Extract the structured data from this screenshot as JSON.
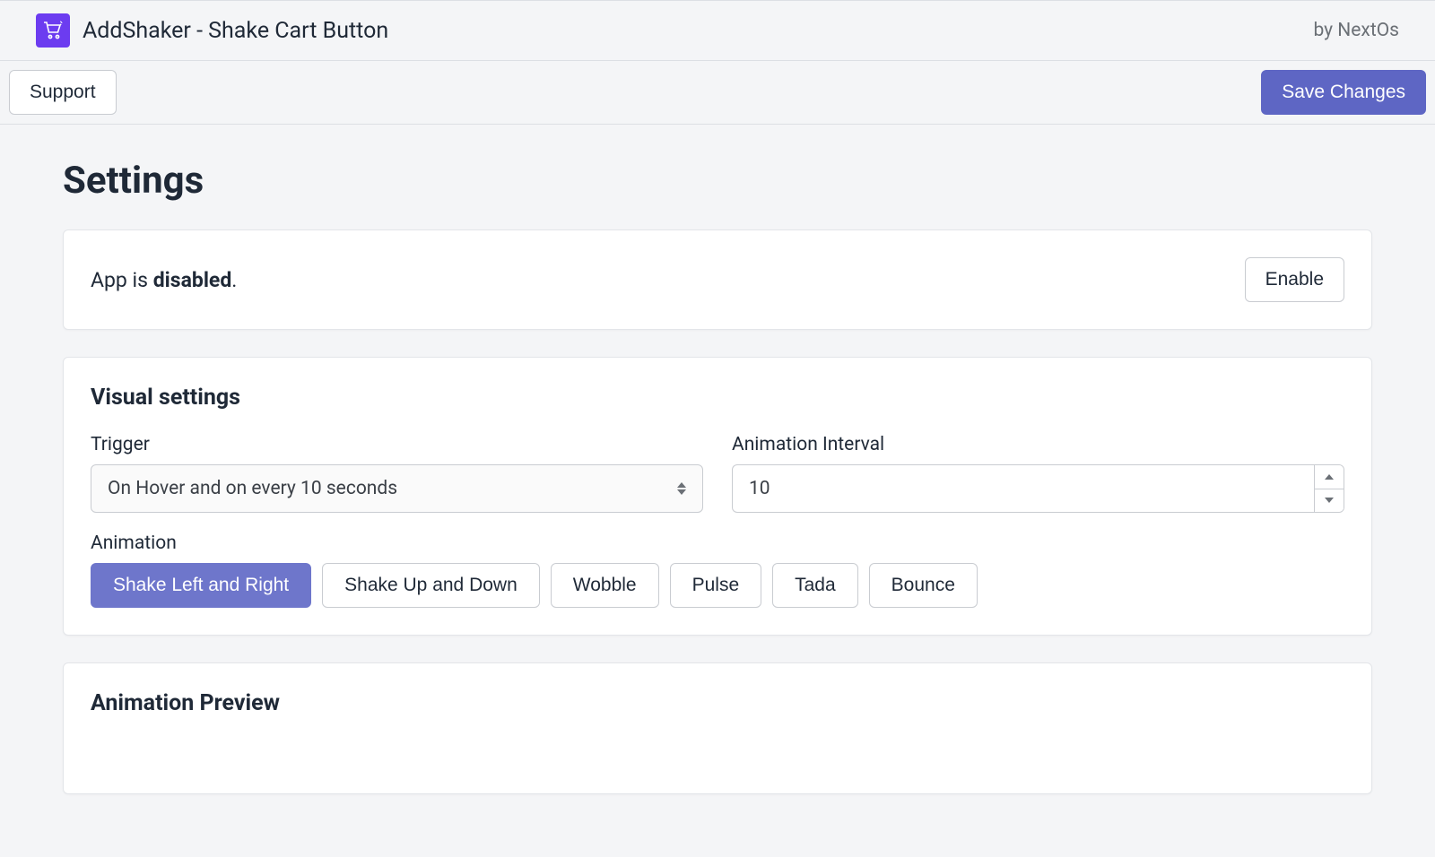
{
  "header": {
    "app_title": "AddShaker - Shake Cart Button",
    "attribution": "by NextOs"
  },
  "toolbar": {
    "support_label": "Support",
    "save_label": "Save Changes"
  },
  "page": {
    "title": "Settings"
  },
  "status": {
    "prefix": "App is ",
    "state": "disabled",
    "suffix": ".",
    "enable_label": "Enable"
  },
  "visual": {
    "section_title": "Visual settings",
    "trigger_label": "Trigger",
    "trigger_value": "On Hover and on every 10 seconds",
    "interval_label": "Animation Interval",
    "interval_value": "10",
    "animation_label": "Animation",
    "animations": [
      {
        "label": "Shake Left and Right",
        "active": true
      },
      {
        "label": "Shake Up and Down",
        "active": false
      },
      {
        "label": "Wobble",
        "active": false
      },
      {
        "label": "Pulse",
        "active": false
      },
      {
        "label": "Tada",
        "active": false
      },
      {
        "label": "Bounce",
        "active": false
      }
    ]
  },
  "preview": {
    "section_title": "Animation Preview"
  }
}
